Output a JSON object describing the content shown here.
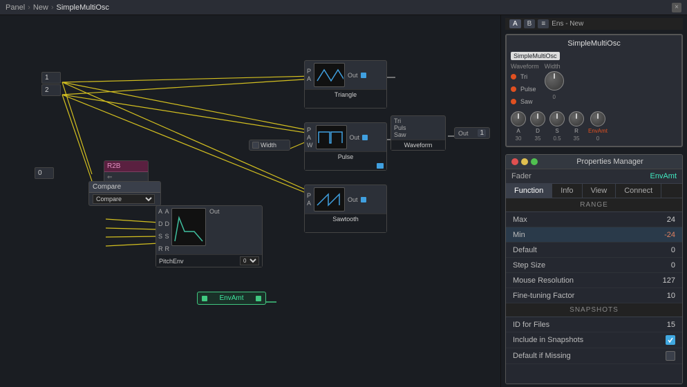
{
  "titleBar": {
    "path": [
      "Panel",
      "New",
      "SimpleMultiOsc"
    ],
    "separators": [
      ">",
      ">"
    ],
    "closeLabel": "×"
  },
  "canvas": {
    "nodes": [
      {
        "id": "num1",
        "label": "1",
        "type": "number"
      },
      {
        "id": "num2",
        "label": "2",
        "type": "number"
      },
      {
        "id": "zero",
        "label": "0",
        "type": "number"
      },
      {
        "id": "r2b",
        "label": "R2B",
        "type": "converter"
      },
      {
        "id": "compare",
        "label": "Compare",
        "type": "logic"
      },
      {
        "id": "width",
        "label": "Width",
        "type": "param"
      },
      {
        "id": "triangle",
        "label": "Triangle",
        "type": "osc"
      },
      {
        "id": "pulse",
        "label": "Pulse",
        "type": "osc"
      },
      {
        "id": "sawtooth",
        "label": "Sawtooth",
        "type": "osc"
      },
      {
        "id": "waveform",
        "label": "Waveform",
        "type": "selector"
      },
      {
        "id": "pitchenv",
        "label": "PitchEnv",
        "type": "env"
      },
      {
        "id": "envamt",
        "label": "EnvAmt",
        "type": "param"
      },
      {
        "id": "out_final",
        "label": "Out",
        "value": "1",
        "type": "output"
      }
    ]
  },
  "ensBar": {
    "btnA": "A",
    "btnB": "B",
    "btnMenu": "≡",
    "label": "Ens - New"
  },
  "pluginPreview": {
    "title": "SimpleMultiOsc",
    "waveformLabel": "Waveform",
    "widthLabel": "Width",
    "options": [
      "Tri",
      "Pulse",
      "Saw"
    ],
    "adsrLabels": [
      "A",
      "D",
      "S",
      "R",
      "EnvAmt"
    ],
    "adsrValues": [
      "30",
      "35",
      "0.5",
      "35",
      "0"
    ]
  },
  "propsManager": {
    "title": "Properties Manager",
    "trafficLights": [
      "red",
      "yellow",
      "green"
    ],
    "faderLabel": "Fader",
    "envAmtLabel": "EnvAmt",
    "tabs": [
      "Function",
      "Info",
      "View",
      "Connect"
    ],
    "activeTab": "Function",
    "sections": {
      "range": {
        "header": "RANGE",
        "rows": [
          {
            "label": "Max",
            "value": "24",
            "highlighted": false
          },
          {
            "label": "Min",
            "value": "-24",
            "highlighted": true,
            "negative": true
          },
          {
            "label": "Default",
            "value": "0",
            "highlighted": false
          },
          {
            "label": "Step Size",
            "value": "0",
            "highlighted": false
          },
          {
            "label": "Mouse Resolution",
            "value": "127",
            "highlighted": false
          },
          {
            "label": "Fine-tuning Factor",
            "value": "10",
            "highlighted": false
          }
        ]
      },
      "snapshots": {
        "header": "SNAPSHOTS",
        "rows": [
          {
            "label": "ID for Files",
            "value": "15",
            "highlighted": false
          },
          {
            "label": "Include in Snapshots",
            "checkbox": true,
            "checked": true
          },
          {
            "label": "Default if Missing",
            "checkbox": true,
            "checked": false
          }
        ]
      }
    }
  }
}
